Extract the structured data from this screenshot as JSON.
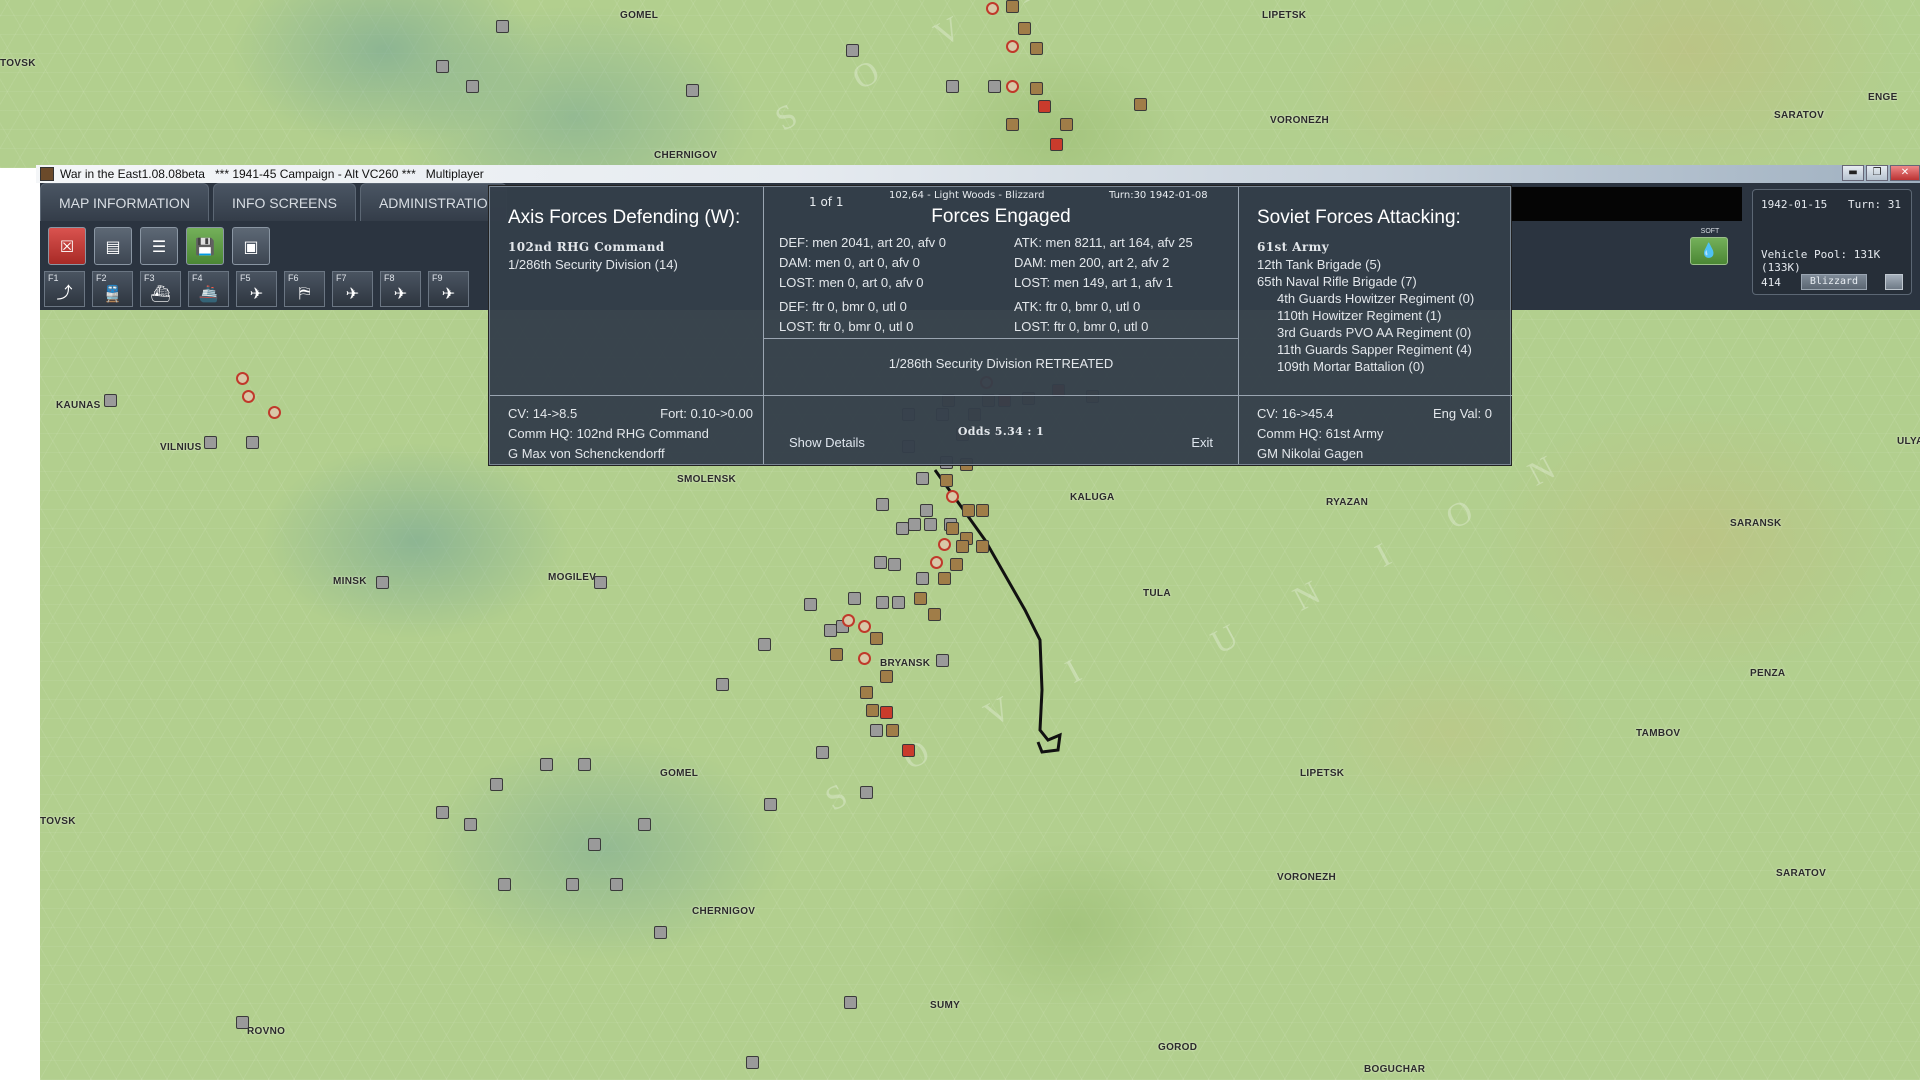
{
  "window": {
    "app_title": "War in the East1.08.08beta",
    "scenario": "***  1941-45 Campaign - Alt VC260  ***",
    "mode": "Multiplayer",
    "buttons": [
      "▬",
      "❐",
      "✕"
    ]
  },
  "tabs": [
    "MAP INFORMATION",
    "INFO SCREENS",
    "ADMINISTRATIO"
  ],
  "toolbar": {
    "buttons": [
      {
        "icon": "close-icon",
        "glyph": "☒"
      },
      {
        "icon": "report-icon",
        "glyph": "▤"
      },
      {
        "icon": "list-icon",
        "glyph": "☰"
      },
      {
        "icon": "save-icon",
        "glyph": "💾"
      },
      {
        "icon": "window-icon",
        "glyph": "▣"
      }
    ],
    "fkeys": [
      {
        "key": "F1",
        "icon": "supply-icon",
        "glyph": "⤴"
      },
      {
        "key": "F2",
        "icon": "train-icon",
        "glyph": "🚆"
      },
      {
        "key": "F3",
        "icon": "ship-icon",
        "glyph": "⛴"
      },
      {
        "key": "F4",
        "icon": "naval-icon",
        "glyph": "🚢"
      },
      {
        "key": "F5",
        "icon": "air-transfer-icon",
        "glyph": "✈"
      },
      {
        "key": "F6",
        "icon": "airfield-icon",
        "glyph": "⛿"
      },
      {
        "key": "F7",
        "icon": "air-attack-icon",
        "glyph": "✈"
      },
      {
        "key": "F8",
        "icon": "bomb-icon",
        "glyph": "✈"
      },
      {
        "key": "F9",
        "icon": "recon-icon",
        "glyph": "✈"
      }
    ]
  },
  "soft_label": "SOFT",
  "soft_glyph": "💧",
  "status": {
    "date": "1942-01-15",
    "turn": "Turn: 31",
    "vehicle_pool": "Vehicle Pool: 131K (133K)",
    "number": "414",
    "weather": "Blizzard"
  },
  "combat": {
    "axis": {
      "header": "Axis Forces Defending (W):",
      "command": "102nd RHG Command",
      "units": [
        "1/286th Security Division (14)"
      ],
      "cv": "CV: 14->8.5",
      "fort": "Fort: 0.10->0.00",
      "comm_hq": "Comm HQ: 102nd RHG Command",
      "leader": "G Max von Schenckendorff"
    },
    "mid": {
      "counter": "1 of 1",
      "location": "102,64 - Light Woods - Blizzard",
      "turn": "Turn:30  1942-01-08",
      "header": "Forces Engaged",
      "def_men": "DEF: men 2041, art 20, afv 0",
      "def_dam": "DAM: men 0, art 0, afv 0",
      "def_lost": "LOST: men 0, art 0, afv 0",
      "def_air": "DEF: ftr 0, bmr 0, utl 0",
      "def_air_lost": "LOST: ftr 0, bmr 0, utl 0",
      "atk_men": "ATK: men 8211, art 164, afv 25",
      "atk_dam": "DAM: men 200, art 2, afv 2",
      "atk_lost": "LOST: men 149, art 1, afv 1",
      "atk_air": "ATK: ftr 0, bmr 0, utl 0",
      "atk_air_lost": "LOST: ftr 0, bmr 0, utl 0",
      "result": "1/286th Security Division RETREATED",
      "show_details": "Show Details",
      "odds": "Odds 5.34 : 1",
      "exit": "Exit"
    },
    "soviet": {
      "header": "Soviet Forces Attacking:",
      "command": "61st Army",
      "units": [
        "12th Tank Brigade (5)",
        "65th Naval Rifle Brigade (7)",
        "4th Guards Howitzer Regiment (0)",
        "110th Howitzer Regiment (1)",
        "3rd Guards PVO AA Regiment (0)",
        "11th Guards Sapper Regiment (4)",
        "109th Mortar Battalion (0)"
      ],
      "cv": "CV: 16->45.4",
      "eng_val": "Eng Val: 0",
      "comm_hq": "Comm HQ: 61st Army",
      "leader": "GM Nikolai Gagen"
    }
  },
  "map": {
    "top_cities": [
      "GOMEL",
      "LIPETSK",
      "VORONEZH",
      "SARATOV",
      "CHERNIGOV",
      "TOVSK",
      "ENGE"
    ],
    "main_cities": [
      "KAUNAS",
      "VILNIUS",
      "SMOLENSK",
      "KALUGA",
      "RYAZAN",
      "SARANSK",
      "MINSK",
      "MOGILEV",
      "TULA",
      "BRYANSK",
      "PENZA",
      "TAMBOV",
      "GOMEL",
      "LIPETSK",
      "TOVSK",
      "VORONEZH",
      "SARATOV",
      "CHERNIGOV",
      "SUMY",
      "ROVNO",
      "GOROD",
      "BOGUCHAR",
      "ULYA"
    ],
    "watermark": [
      "S O V I",
      "U N I O N",
      "S O V I",
      "T",
      "U N I T"
    ]
  }
}
